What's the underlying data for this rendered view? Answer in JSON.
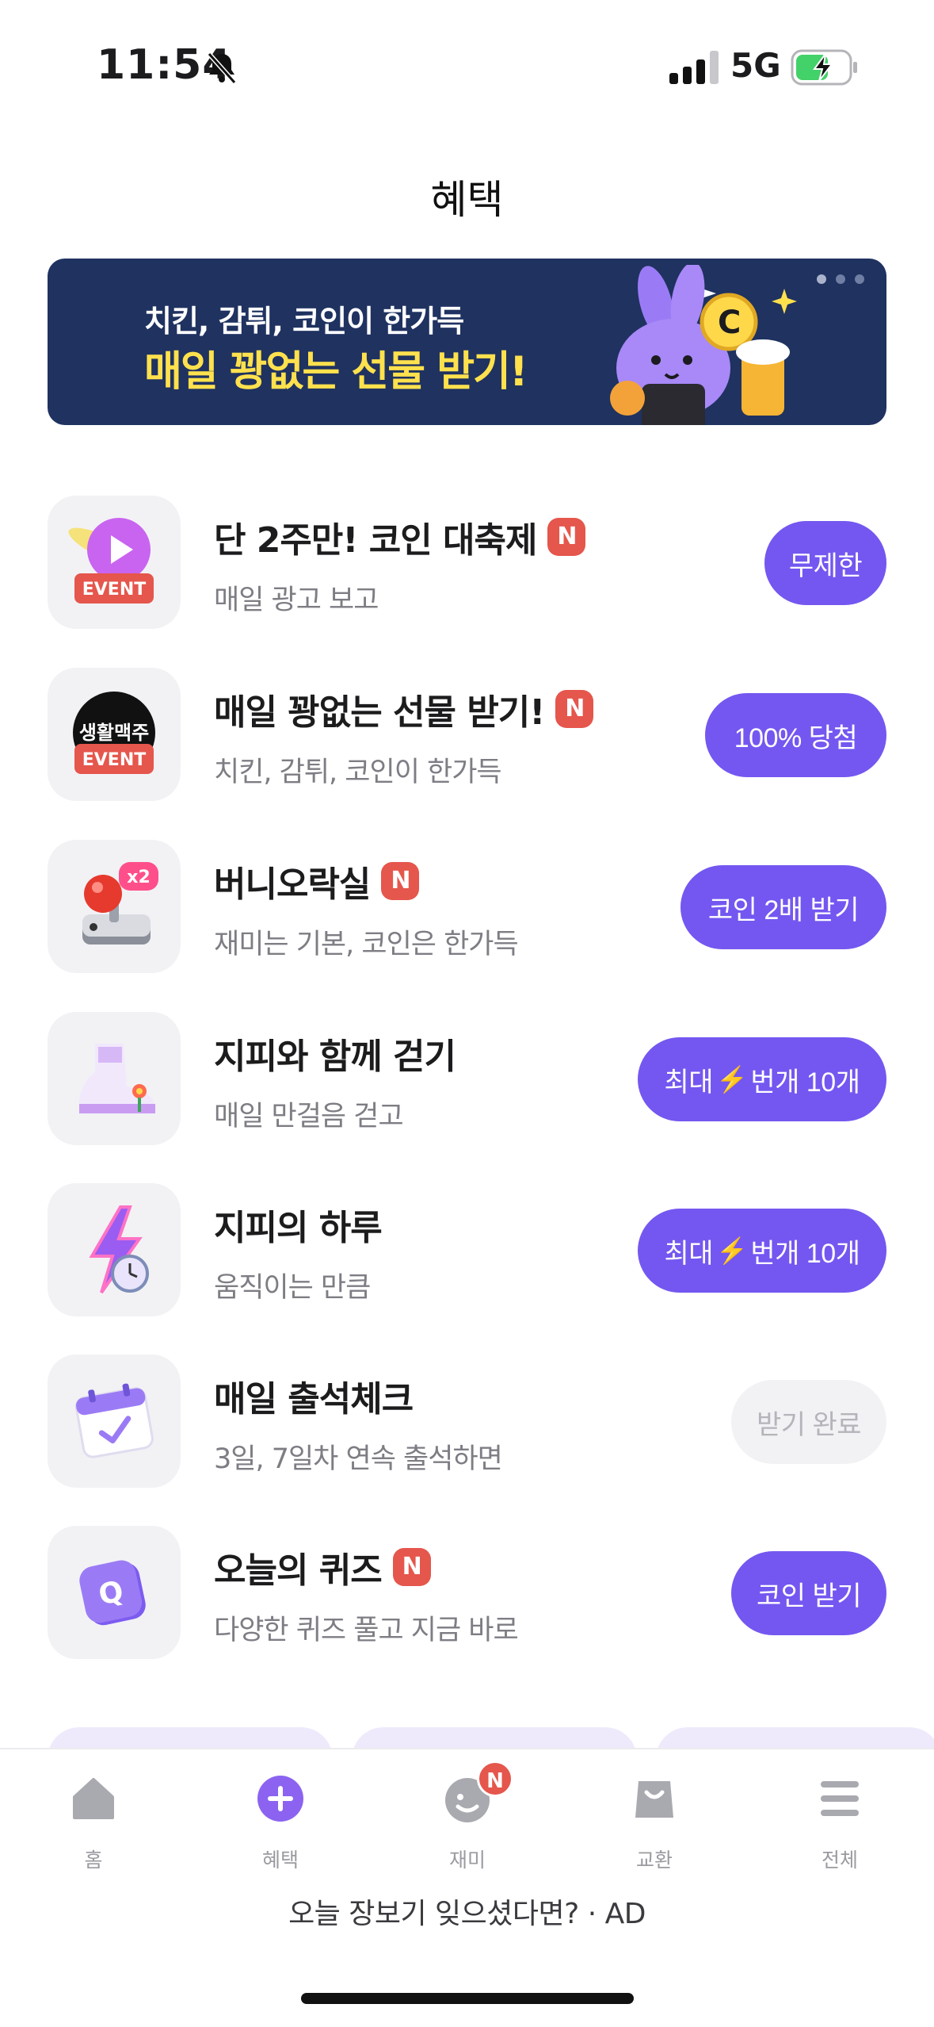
{
  "status_bar": {
    "time": "11:54",
    "network": "5G"
  },
  "header": {
    "title": "혜택"
  },
  "banner": {
    "subtitle": "치킨, 감튀, 코인이 한가득",
    "title": "매일 꽝없는 선물 받기!",
    "page_count": 3,
    "active_page": 1
  },
  "benefits": [
    {
      "title": "단 2주만! 코인 대축제",
      "new": "N",
      "subtitle": "매일 광고 보고",
      "button": "무제한",
      "icon": "event-play-icon",
      "icon_badge": "EVENT"
    },
    {
      "title": "매일 꽝없는 선물 받기!",
      "new": "N",
      "subtitle": "치킨, 감튀, 코인이 한가득",
      "button": "100% 당첨",
      "icon": "event-beer-icon",
      "icon_text": "생활맥주",
      "icon_badge": "EVENT"
    },
    {
      "title": "버니오락실",
      "new": "N",
      "subtitle": "재미는 기본, 코인은 한가득",
      "button": "코인 2배 받기",
      "icon": "joystick-icon",
      "icon_badge": "x2"
    },
    {
      "title": "지피와 함께 걷기",
      "subtitle": "매일 만걸음 걷고",
      "button_prefix": "최대",
      "button_bolt": "⚡",
      "button_suffix": "번개 10개",
      "icon": "sneaker-icon"
    },
    {
      "title": "지피의 하루",
      "subtitle": "움직이는 만큼",
      "button_prefix": "최대",
      "button_bolt": "⚡",
      "button_suffix": "번개 10개",
      "icon": "lightning-clock-icon"
    },
    {
      "title": "매일 출석체크",
      "subtitle": "3일, 7일차 연속 출석하면",
      "button": "받기 완료",
      "button_state": "disabled",
      "icon": "calendar-check-icon"
    },
    {
      "title": "오늘의 퀴즈",
      "new": "N",
      "subtitle": "다양한 퀴즈 풀고 지금 바로",
      "button": "코인 받기",
      "icon": "quiz-icon",
      "icon_letter": "Q"
    }
  ],
  "tabs": [
    {
      "label": "홈",
      "icon": "home-icon"
    },
    {
      "label": "혜택",
      "icon": "plus-icon",
      "active": true
    },
    {
      "label": "재미",
      "icon": "smile-icon",
      "badge": "N"
    },
    {
      "label": "교환",
      "icon": "shopping-bag-icon"
    },
    {
      "label": "전체",
      "icon": "menu-icon"
    }
  ],
  "ad": {
    "text": "오늘 장보기 잊으셨다면? · AD"
  },
  "colors": {
    "accent": "#7457f0",
    "banner_bg": "#1f3260",
    "banner_title": "#ffe14d",
    "new_badge": "#e5564c"
  }
}
